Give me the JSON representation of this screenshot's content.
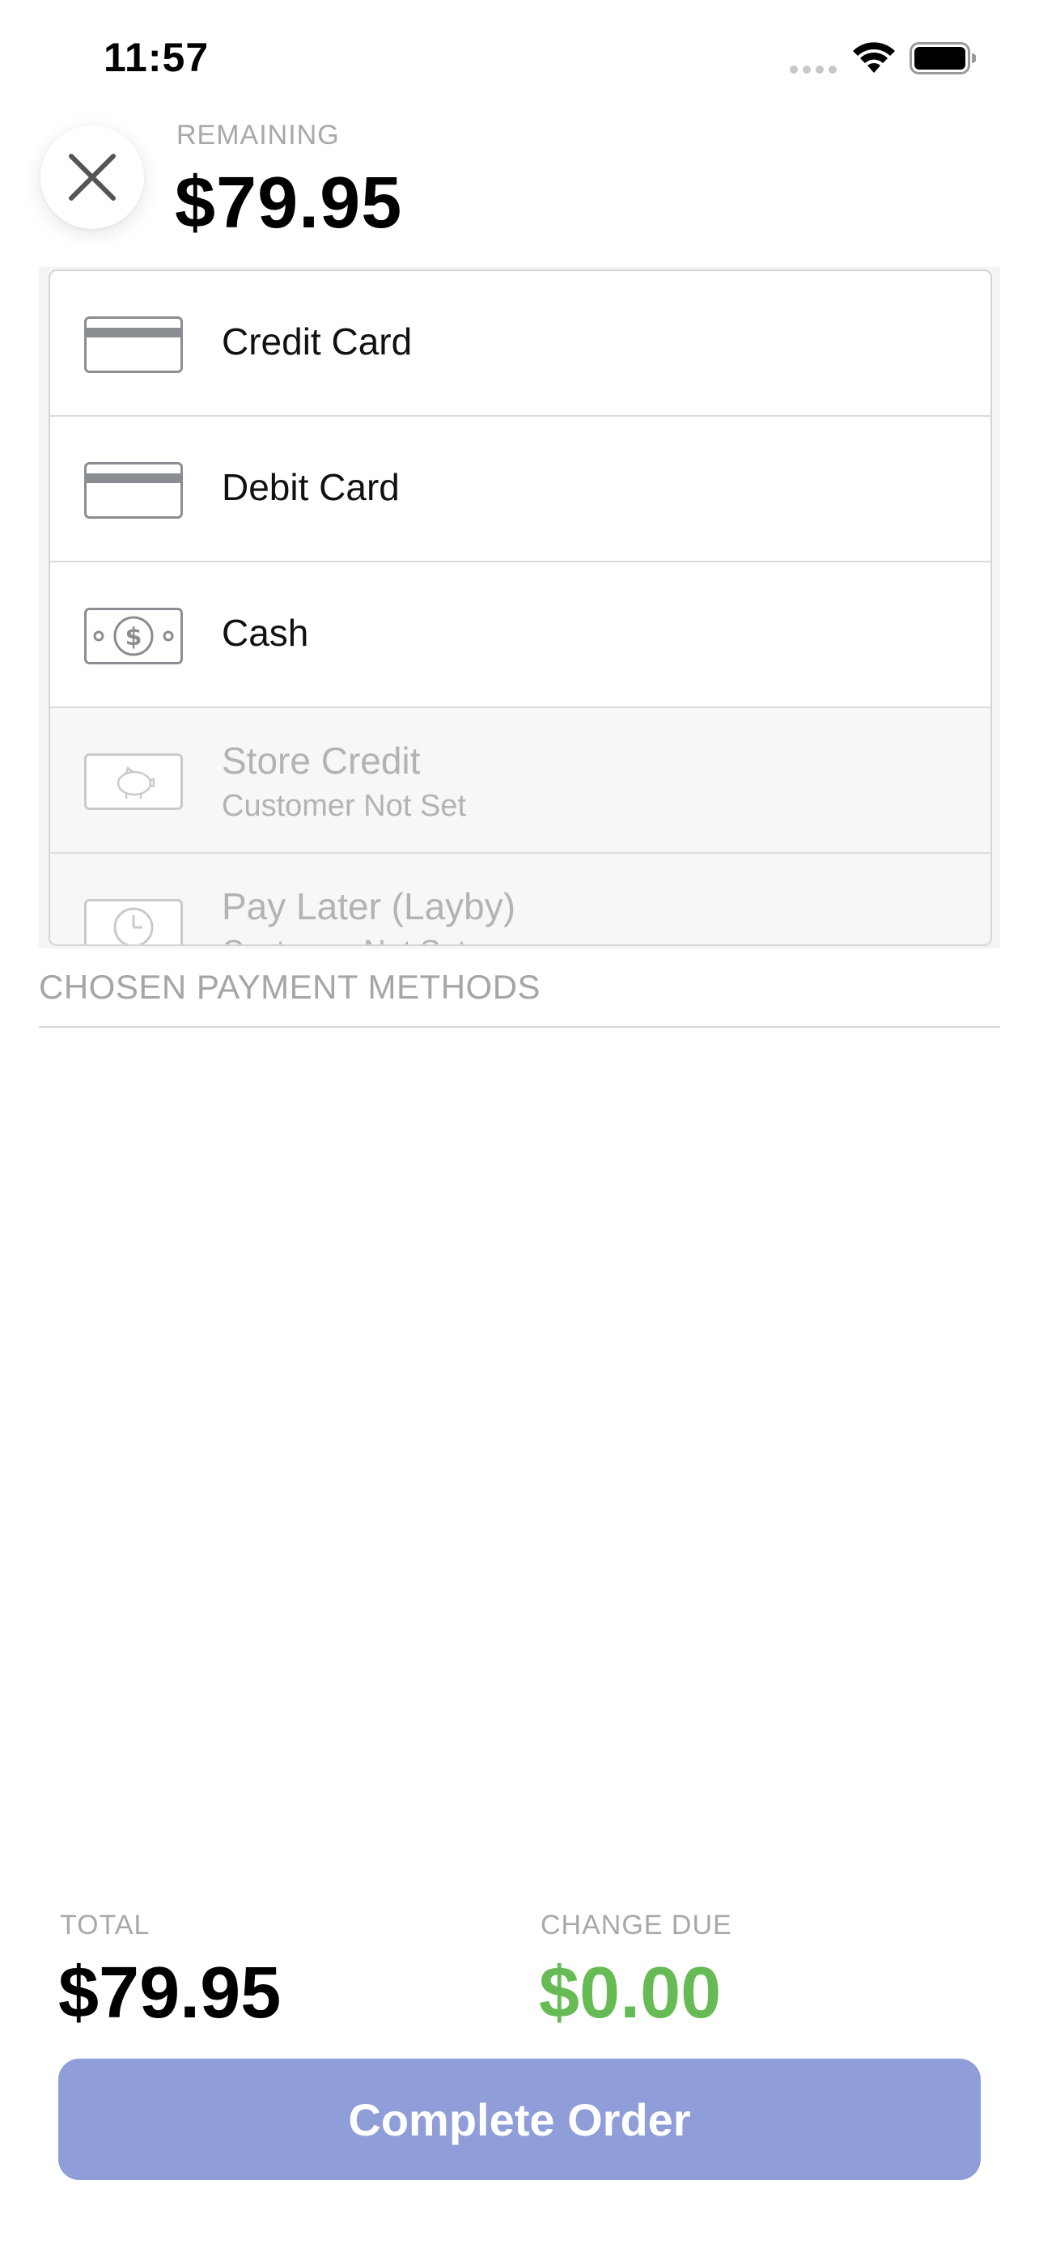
{
  "status_bar": {
    "time": "11:57",
    "icons": [
      "cellular-signal-icon",
      "wifi-icon",
      "battery-icon"
    ]
  },
  "header": {
    "close_icon": "close-icon",
    "remaining_label": "REMAINING",
    "remaining_amount": "$79.95"
  },
  "payment_methods": [
    {
      "label": "Credit Card",
      "subtitle": "",
      "icon": "credit-card-icon",
      "enabled": true
    },
    {
      "label": "Debit Card",
      "subtitle": "",
      "icon": "debit-card-icon",
      "enabled": true
    },
    {
      "label": "Cash",
      "subtitle": "",
      "icon": "cash-icon",
      "enabled": true
    },
    {
      "label": "Store Credit",
      "subtitle": "Customer Not Set",
      "icon": "piggy-bank-icon",
      "enabled": false
    },
    {
      "label": "Pay Later (Layby)",
      "subtitle": "Customer Not Set",
      "icon": "clock-icon",
      "enabled": false
    }
  ],
  "chosen": {
    "heading": "CHOSEN PAYMENT METHODS"
  },
  "totals": {
    "total_label": "TOTAL",
    "total_amount": "$79.95",
    "change_label": "CHANGE DUE",
    "change_amount": "$0.00"
  },
  "complete_button": {
    "label": "Complete Order"
  },
  "colors": {
    "change_due": "#66bb55",
    "complete_button_bg": "#8f9dd8",
    "muted_text": "#a8a8a8",
    "icon_stroke": "#8a8d91"
  }
}
